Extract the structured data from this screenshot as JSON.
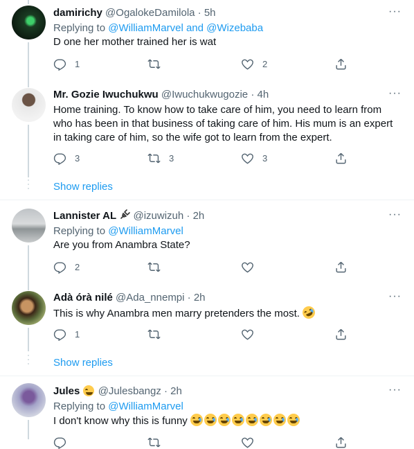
{
  "tweets": [
    {
      "name": "damirichy",
      "handle": "@OgalokeDamilola",
      "time": "5h",
      "replying_prefix": "Replying to",
      "replying_mentions": "@WilliamMarvel and @Wizebaba",
      "text": "D one her mother trained her is wat",
      "reply_count": "1",
      "retweet_count": "",
      "like_count": "2"
    },
    {
      "name": "Mr. Gozie Iwuchukwu",
      "handle": "@Iwuchukwugozie",
      "time": "4h",
      "text": "Home training. To know how to take care of him, you need to learn from who has been in that business of taking care of him. His mum is an expert in taking care of him, so the wife got to learn from the expert.",
      "reply_count": "3",
      "retweet_count": "3",
      "like_count": "3",
      "show_replies": "Show replies"
    },
    {
      "name": "Lannister AL",
      "handle": "@izuwizuh",
      "time": "2h",
      "replying_prefix": "Replying to",
      "replying_mentions": "@WilliamMarvel",
      "text": "Are you from Anambra State?",
      "reply_count": "2",
      "retweet_count": "",
      "like_count": ""
    },
    {
      "name": "Adà órà nilé",
      "handle": "@Ada_nnempi",
      "time": "2h",
      "text": "This is why Anambra men marry pretenders the most.",
      "reply_count": "1",
      "retweet_count": "",
      "like_count": "",
      "show_replies": "Show replies"
    },
    {
      "name": "Jules",
      "handle": "@Julesbangz",
      "time": "2h",
      "replying_prefix": "Replying to",
      "replying_mentions": "@WilliamMarvel",
      "text": "I don't know why this is funny"
    }
  ],
  "separator": "·",
  "more_label": "···",
  "icons": {
    "reply": "reply-icon",
    "retweet": "retweet-icon",
    "like": "heart-icon",
    "share": "share-icon",
    "plug": "plug-icon",
    "emoji_laugh": "tears-of-joy-emoji",
    "emoji_rofl": "rofl-emoji",
    "emoji_smile": "smiling-face-emoji"
  },
  "colors": {
    "accent": "#1d9bf0",
    "muted": "#536471",
    "text": "#0f1419",
    "thread_line": "#cfd9de",
    "divider": "#eff3f4"
  }
}
